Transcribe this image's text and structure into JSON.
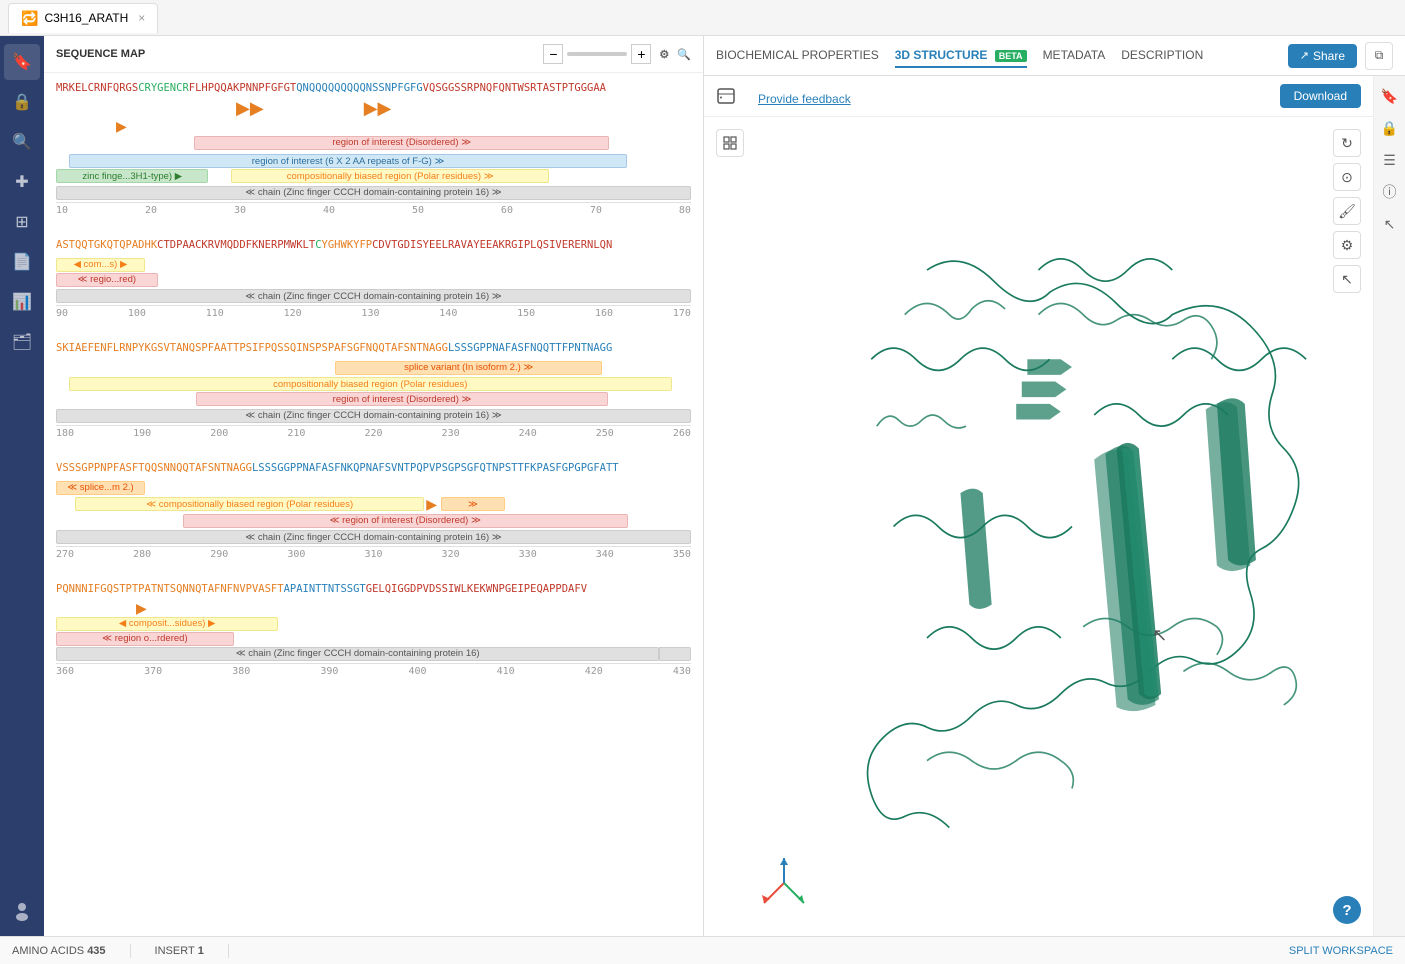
{
  "tab": {
    "icon": "🔁",
    "label": "C3H16_ARATH",
    "close": "×"
  },
  "left_panel": {
    "header": "SEQUENCE MAP",
    "zoom_minus": "−",
    "zoom_plus": "+",
    "settings_icon": "⚙",
    "search_icon": "🔍"
  },
  "sequences": [
    {
      "id": "seq1",
      "text": "MRKELCRNFQRGSCRYGENCRFLHPQQAKPNNPFGFGTQNQQQQQQQQQNSSNPFGFGVQSGGSSRPNQFQNTWSRTASTPTGGGAA",
      "features": [
        {
          "label": "region of interest (Disordered)",
          "class": "feat-pink",
          "width_pct": 65,
          "left_pct": 20
        },
        {
          "label": "region of interest (6 X 2 AA repeats of F-G)",
          "class": "feat-blue",
          "width_pct": 80,
          "left_pct": 5
        },
        {
          "label": "zinc finge...3H1-type)",
          "class": "feat-green",
          "width_pct": 20,
          "left_pct": 0
        },
        {
          "label": "compositionally biased region (Polar residues)",
          "class": "feat-yellow",
          "width_pct": 45,
          "left_pct": 28
        },
        {
          "label": "chain (Zinc finger CCCH domain-containing protein 16)",
          "class": "feat-gray",
          "width_pct": 100,
          "left_pct": 0
        }
      ],
      "ruler": [
        "10",
        "20",
        "30",
        "40",
        "50",
        "60",
        "70",
        "80"
      ]
    },
    {
      "id": "seq2",
      "text": "ASTQQTGKQTQPADHKCTDPAACKRVMQDDFKNERPMWKLTCYGHWKYFPCDVTGDISYEELRAVAYEEAKRGIPLQSIVERERNLQN",
      "features": [
        {
          "label": "com...s)",
          "class": "feat-yellow",
          "width_pct": 12,
          "left_pct": 0
        },
        {
          "label": "regio...red)",
          "class": "feat-pink",
          "width_pct": 14,
          "left_pct": 0
        },
        {
          "label": "chain (Zinc finger CCCH domain-containing protein 16)",
          "class": "feat-gray",
          "width_pct": 100,
          "left_pct": 0
        }
      ],
      "ruler": [
        "90",
        "100",
        "110",
        "120",
        "130",
        "140",
        "150",
        "160",
        "170"
      ]
    },
    {
      "id": "seq3",
      "text": "SKIAEFENFLRNPYKGSVTANQSPFAATTPSIFPQSSQINSPSPAFSGFNQQTAFSNTNAGGLS SSGPPNAFASFNQQTTFPNTNAGG",
      "features": [
        {
          "label": "splice variant (In isoform 2.)",
          "class": "feat-orange",
          "width_pct": 40,
          "left_pct": 45
        },
        {
          "label": "compositionally biased region (Polar residues)",
          "class": "feat-yellow",
          "width_pct": 80,
          "left_pct": 5
        },
        {
          "label": "region of interest (Disordered)",
          "class": "feat-pink",
          "width_pct": 60,
          "left_pct": 20
        },
        {
          "label": "chain (Zinc finger CCCH domain-containing protein 16)",
          "class": "feat-gray",
          "width_pct": 100,
          "left_pct": 0
        }
      ],
      "ruler": [
        "180",
        "190",
        "200",
        "210",
        "220",
        "230",
        "240",
        "250",
        "260"
      ]
    },
    {
      "id": "seq4",
      "text": "VSSSGPPNPFASFTQQSNNQQTAFSNTNAGG LSSSGGPPNAFASFNKQPNAFSVNTPQPVPSGPSGFQTNPSTTFKPASFGPGPGFATT",
      "features": [
        {
          "label": "splice...m 2.)",
          "class": "feat-orange",
          "width_pct": 14,
          "left_pct": 0
        },
        {
          "label": "compositionally biased region (Polar residues)",
          "class": "feat-yellow",
          "width_pct": 75,
          "left_pct": 5
        },
        {
          "label": "region of interest (Disordered)",
          "class": "feat-pink",
          "width_pct": 55,
          "left_pct": 25
        },
        {
          "label": "chain (Zinc finger CCCH domain-containing protein 16)",
          "class": "feat-gray",
          "width_pct": 100,
          "left_pct": 0
        }
      ],
      "ruler": [
        "270",
        "280",
        "290",
        "300",
        "310",
        "320",
        "330",
        "340",
        "350"
      ]
    },
    {
      "id": "seq5",
      "text": "PQNNNIFGQSTPTPATNTSQNNQTAFNFNVPVASFTAPAINTTNTSSGTGELQIGGDPVDSSIWLKEKWNPGEIPEQAPPDAFV",
      "features": [
        {
          "label": "composit...sidues)",
          "class": "feat-yellow",
          "width_pct": 30,
          "left_pct": 0
        },
        {
          "label": "region o...rdered)",
          "class": "feat-pink",
          "width_pct": 25,
          "left_pct": 0
        },
        {
          "label": "chain (Zinc finger CCCH domain-containing protein 16)",
          "class": "feat-gray",
          "width_pct": 100,
          "left_pct": 0
        }
      ],
      "ruler": [
        "360",
        "370",
        "380",
        "390",
        "400",
        "410",
        "420",
        "430"
      ]
    }
  ],
  "right_tabs": [
    {
      "id": "biochem",
      "label": "BIOCHEMICAL PROPERTIES",
      "active": false
    },
    {
      "id": "structure",
      "label": "3D STRUCTURE",
      "active": true,
      "badge": "BETA"
    },
    {
      "id": "metadata",
      "label": "METADATA",
      "active": false
    },
    {
      "id": "description",
      "label": "DESCRIPTION",
      "active": false
    }
  ],
  "viewer": {
    "feedback_label": "Provide feedback",
    "download_label": "Download",
    "share_label": "Share"
  },
  "status_bar": {
    "amino_acids_label": "AMINO ACIDS",
    "amino_acids_count": "435",
    "insert_label": "INSERT",
    "insert_num": "1",
    "split_workspace": "SPLIT WORKSPACE"
  },
  "sidebar_icons": [
    "🔖",
    "🔒",
    "🔍",
    "✚",
    "⊞",
    "📄",
    "📊",
    "🗂️",
    "👤"
  ]
}
